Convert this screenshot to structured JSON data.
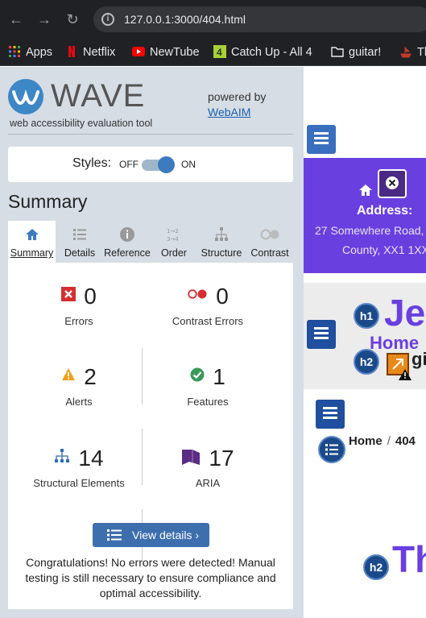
{
  "browser": {
    "url": "127.0.0.1:3000/404.html",
    "bookmarks": [
      {
        "label": "Apps",
        "icon": "apps-grid-icon"
      },
      {
        "label": "Netflix",
        "icon": "netflix-icon"
      },
      {
        "label": "NewTube",
        "icon": "youtube-icon"
      },
      {
        "label": "Catch Up - All 4",
        "icon": "channel4-icon"
      },
      {
        "label": "guitar!",
        "icon": "folder-icon"
      },
      {
        "label": "Th",
        "icon": "ship-icon"
      }
    ]
  },
  "wave": {
    "logo": "WAVE",
    "tagline": "web accessibility evaluation tool",
    "powered_by": "powered by",
    "webaim": "WebAIM",
    "styles_label": "Styles:",
    "styles_off": "OFF",
    "styles_on": "ON",
    "summary_title": "Summary",
    "tabs": [
      {
        "label": "Summary",
        "icon": "home-icon",
        "active": true
      },
      {
        "label": "Details",
        "icon": "list-icon",
        "active": false
      },
      {
        "label": "Reference",
        "icon": "info-icon",
        "active": false
      },
      {
        "label": "Order",
        "icon": "order-icon",
        "active": false
      },
      {
        "label": "Structure",
        "icon": "structure-icon",
        "active": false
      },
      {
        "label": "Contrast",
        "icon": "contrast-icon",
        "active": false
      }
    ],
    "stats": {
      "errors": {
        "value": "0",
        "label": "Errors"
      },
      "contrast_errors": {
        "value": "0",
        "label": "Contrast Errors"
      },
      "alerts": {
        "value": "2",
        "label": "Alerts"
      },
      "features": {
        "value": "1",
        "label": "Features"
      },
      "structural": {
        "value": "14",
        "label": "Structural Elements"
      },
      "aria": {
        "value": "17",
        "label": "ARIA"
      }
    },
    "view_details": "View details ›",
    "congrats": "Congratulations! No errors were detected! Manual testing is still necessary to ensure compliance and optimal accessibility."
  },
  "page": {
    "address_label": "Address:",
    "address_line1": "27 Somewhere Road,",
    "address_line2": "County, XX1 1XX",
    "heading_partial": "Je",
    "home_partial": "Home",
    "gi_partial": "gi",
    "breadcrumb_home": "Home",
    "breadcrumb_sep": "/",
    "breadcrumb_current": "404",
    "title_partial": "Th",
    "badges": {
      "h1": "h1",
      "h2": "h2"
    }
  },
  "colors": {
    "brand_purple": "#6a3fe0",
    "wave_blue": "#3d87c7",
    "panel_bg": "#d6dde5"
  }
}
